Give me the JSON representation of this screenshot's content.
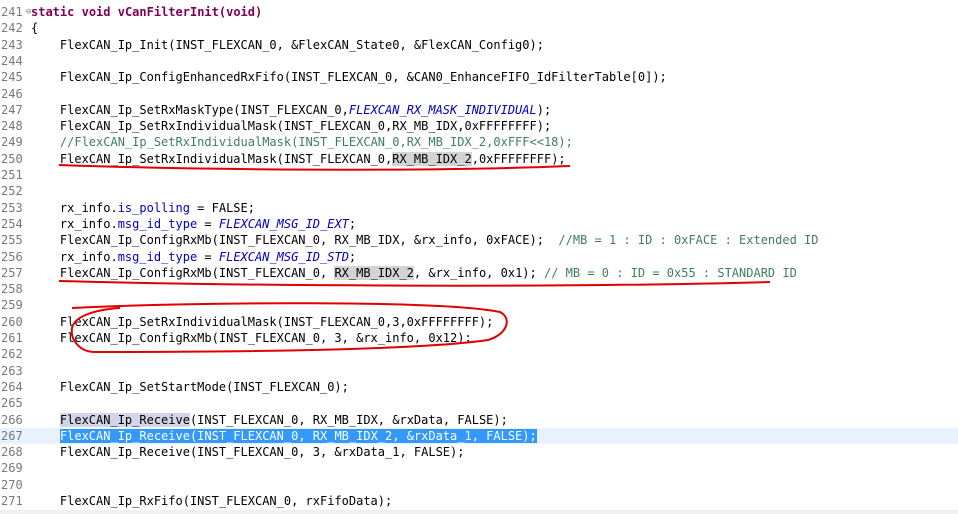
{
  "editor": {
    "lines": [
      {
        "n": "241",
        "tokens": [
          {
            "t": "static",
            "c": "kw"
          },
          {
            "t": " "
          },
          {
            "t": "void",
            "c": "kw"
          },
          {
            "t": " "
          },
          {
            "t": "vCanFilterInit(",
            "c": "kw"
          },
          {
            "t": "void",
            "c": "kw"
          },
          {
            "t": ")",
            "c": "kw"
          }
        ]
      },
      {
        "n": "242",
        "tokens": [
          {
            "t": "{"
          }
        ]
      },
      {
        "n": "243",
        "tokens": [
          {
            "t": "    FlexCAN_Ip_Init(INST_FLEXCAN_0, &FlexCAN_State0, &FlexCAN_Config0);"
          }
        ]
      },
      {
        "n": "244",
        "tokens": []
      },
      {
        "n": "245",
        "tokens": [
          {
            "t": "    FlexCAN_Ip_ConfigEnhancedRxFifo(INST_FLEXCAN_0, &CAN0_EnhanceFIFO_IdFilterTable[0]);"
          }
        ]
      },
      {
        "n": "246",
        "tokens": []
      },
      {
        "n": "247",
        "tokens": [
          {
            "t": "    FlexCAN_Ip_SetRxMaskType(INST_FLEXCAN_0,"
          },
          {
            "t": "FLEXCAN_RX_MASK_INDIVIDUAL",
            "c": "enum"
          },
          {
            "t": ");"
          }
        ]
      },
      {
        "n": "248",
        "tokens": [
          {
            "t": "    FlexCAN_Ip_SetRxIndividualMask(INST_FLEXCAN_0,RX_MB_IDX,0xFFFFFFFF);"
          }
        ]
      },
      {
        "n": "249",
        "tokens": [
          {
            "t": "    "
          },
          {
            "t": "//FlexCAN_Ip_SetRxIndividualMask(INST_FLEXCAN_0,RX_MB_IDX_2,0xFFF<<18);",
            "c": "comment"
          }
        ]
      },
      {
        "n": "250",
        "tokens": [
          {
            "t": "    FlexCAN_Ip_SetRxIndividualMask(INST_FLEXCAN_0,"
          },
          {
            "t": "RX_MB_IDX_2",
            "c": "hl"
          },
          {
            "t": ",0xFFFFFFFF);"
          }
        ]
      },
      {
        "n": "251",
        "tokens": []
      },
      {
        "n": "252",
        "tokens": []
      },
      {
        "n": "253",
        "tokens": [
          {
            "t": "    rx_info."
          },
          {
            "t": "is_polling",
            "c": "field"
          },
          {
            "t": " = FALSE;"
          }
        ]
      },
      {
        "n": "254",
        "tokens": [
          {
            "t": "    rx_info."
          },
          {
            "t": "msg_id_type",
            "c": "field"
          },
          {
            "t": " = "
          },
          {
            "t": "FLEXCAN_MSG_ID_EXT",
            "c": "enum"
          },
          {
            "t": ";"
          }
        ]
      },
      {
        "n": "255",
        "tokens": [
          {
            "t": "    FlexCAN_Ip_ConfigRxMb(INST_FLEXCAN_0, RX_MB_IDX, &rx_info, 0xFACE);  "
          },
          {
            "t": "//MB = 1 : ID : 0xFACE : Extended ID",
            "c": "comment"
          }
        ]
      },
      {
        "n": "256",
        "tokens": [
          {
            "t": "    rx_info."
          },
          {
            "t": "msg_id_type",
            "c": "field"
          },
          {
            "t": " = "
          },
          {
            "t": "FLEXCAN_MSG_ID_STD",
            "c": "enum"
          },
          {
            "t": ";"
          }
        ]
      },
      {
        "n": "257",
        "tokens": [
          {
            "t": "    FlexCAN_Ip_ConfigRxMb(INST_FLEXCAN_0, "
          },
          {
            "t": "RX_MB_IDX_2",
            "c": "hl"
          },
          {
            "t": ", &rx_info, 0x1); "
          },
          {
            "t": "// MB = 0 : ID = 0x55 : STANDARD ID",
            "c": "comment"
          }
        ]
      },
      {
        "n": "258",
        "tokens": []
      },
      {
        "n": "259",
        "tokens": []
      },
      {
        "n": "260",
        "tokens": [
          {
            "t": "    FlexCAN_Ip_SetRxIndividualMask(INST_FLEXCAN_0,3,0xFFFFFFFF);"
          }
        ]
      },
      {
        "n": "261",
        "tokens": [
          {
            "t": "    FlexCAN_Ip_ConfigRxMb(INST_FLEXCAN_0, 3, &rx_info, 0x12);"
          }
        ]
      },
      {
        "n": "262",
        "tokens": []
      },
      {
        "n": "263",
        "tokens": []
      },
      {
        "n": "264",
        "tokens": [
          {
            "t": "    FlexCAN_Ip_SetStartMode(INST_FLEXCAN_0);"
          }
        ]
      },
      {
        "n": "265",
        "tokens": []
      },
      {
        "n": "266",
        "tokens": [
          {
            "t": "    "
          },
          {
            "t": "FlexCAN_Ip_Receive",
            "c": "occ"
          },
          {
            "t": "(INST_FLEXCAN_0, RX_MB_IDX, &rxData, FALSE);"
          }
        ]
      },
      {
        "n": "267",
        "current": true,
        "tokens": [
          {
            "t": "    "
          },
          {
            "t": "FlexCAN_Ip_Receive(INST_FLEXCAN_0, RX_MB_IDX_2, &rxData_1, FALSE);",
            "c": "sel"
          }
        ]
      },
      {
        "n": "268",
        "tokens": [
          {
            "t": "    FlexCAN_Ip_Receive(INST_FLEXCAN_0, 3, &rxData_1, FALSE);"
          }
        ]
      },
      {
        "n": "269",
        "tokens": []
      },
      {
        "n": "270",
        "tokens": []
      },
      {
        "n": "271",
        "tokens": [
          {
            "t": "    FlexCAN_Ip_RxFifo(INST_FLEXCAN_0, rxFifoData);"
          }
        ]
      }
    ],
    "fold_marker": "⊖",
    "fold_line": "241"
  },
  "colors": {
    "keyword": "#7f0055",
    "field": "#0000c0",
    "comment": "#3f7f5f",
    "selection": "#3399ff",
    "annotation": "#e00000"
  }
}
